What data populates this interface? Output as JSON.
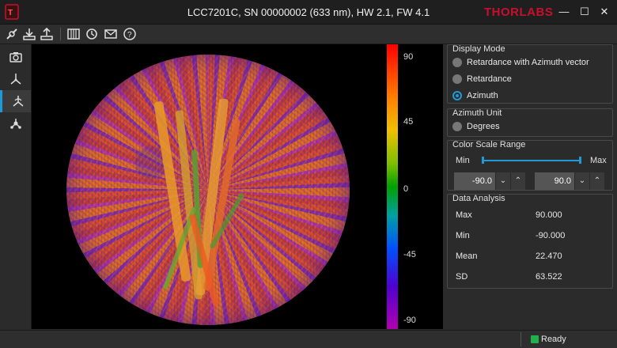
{
  "window": {
    "title": "LCC7201C, SN 00000002 (633 nm), HW 2.1, FW 4.1",
    "brand": "THORLABS",
    "minimize": "—",
    "maximize": "☐",
    "close": "✕"
  },
  "toolbar": {
    "icons": [
      "connect-icon",
      "download-icon",
      "upload-icon",
      "grid-icon",
      "refresh-icon",
      "mail-icon",
      "help-icon"
    ]
  },
  "sidebar": {
    "items": [
      {
        "icon": "camera-icon",
        "active": false
      },
      {
        "icon": "axis-icon",
        "active": false
      },
      {
        "icon": "azimuth-axis-icon",
        "active": true
      },
      {
        "icon": "molecule-icon",
        "active": false
      }
    ]
  },
  "colorbar": {
    "ticks": [
      "90",
      "45",
      "0",
      "-45",
      "-90"
    ]
  },
  "display_mode": {
    "title": "Display Mode",
    "options": [
      {
        "label": "Retardance with Azimuth vector",
        "selected": false
      },
      {
        "label": "Retardance",
        "selected": false
      },
      {
        "label": "Azimuth",
        "selected": true
      }
    ]
  },
  "azimuth_unit": {
    "title": "Azimuth Unit",
    "option": "Degrees"
  },
  "color_scale": {
    "title": "Color Scale Range",
    "min_label": "Min",
    "max_label": "Max",
    "min_value": "-90.0",
    "max_value": "90.0",
    "down": "⌄",
    "up": "⌃"
  },
  "data_analysis": {
    "title": "Data Analysis",
    "rows": [
      {
        "label": "Max",
        "value": "90.000"
      },
      {
        "label": "Min",
        "value": "-90.000"
      },
      {
        "label": "Mean",
        "value": "22.470"
      },
      {
        "label": "SD",
        "value": "63.522"
      }
    ]
  },
  "status": {
    "text": "Ready"
  }
}
